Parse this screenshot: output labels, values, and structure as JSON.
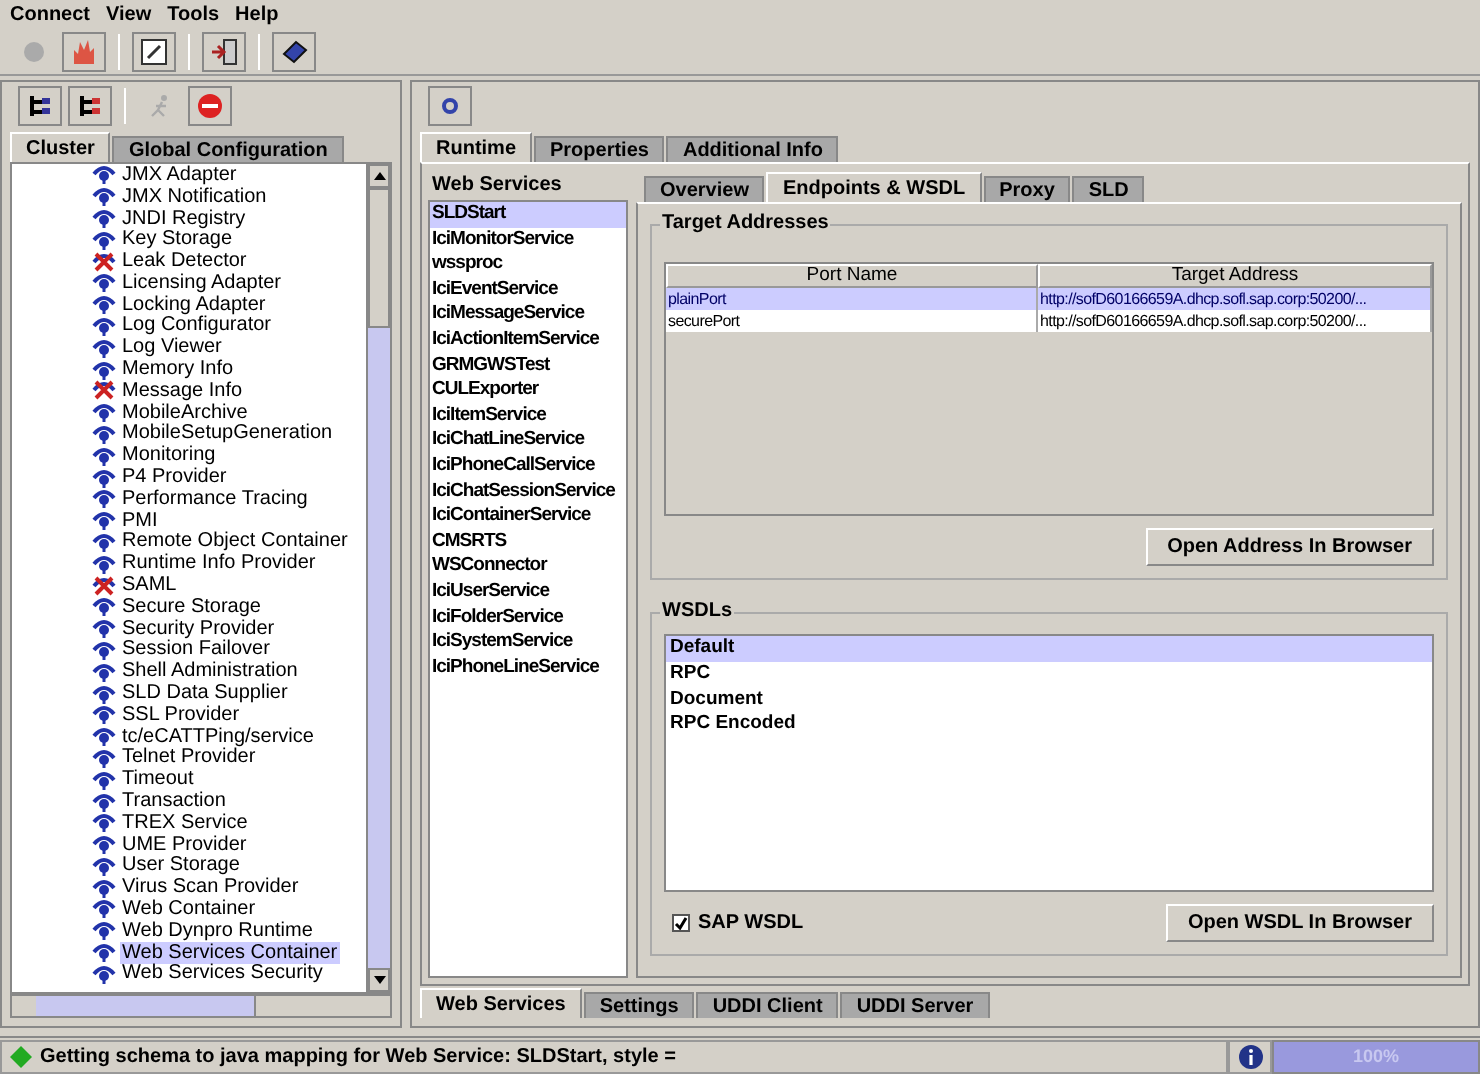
{
  "menu": [
    "Connect",
    "View",
    "Tools",
    "Help"
  ],
  "left_tabs": [
    {
      "label": "Cluster",
      "selected": true
    },
    {
      "label": "Global Configuration",
      "selected": false
    }
  ],
  "tree": [
    {
      "label": "JMX Adapter",
      "kind": "running",
      "selected": false
    },
    {
      "label": "JMX Notification",
      "kind": "running",
      "selected": false
    },
    {
      "label": "JNDI Registry",
      "kind": "running",
      "selected": false
    },
    {
      "label": "Key Storage",
      "kind": "running",
      "selected": false
    },
    {
      "label": "Leak Detector",
      "kind": "stopped",
      "selected": false
    },
    {
      "label": "Licensing Adapter",
      "kind": "running",
      "selected": false
    },
    {
      "label": "Locking Adapter",
      "kind": "running",
      "selected": false
    },
    {
      "label": "Log Configurator",
      "kind": "running",
      "selected": false
    },
    {
      "label": "Log Viewer",
      "kind": "running",
      "selected": false
    },
    {
      "label": "Memory Info",
      "kind": "running",
      "selected": false
    },
    {
      "label": "Message Info",
      "kind": "stopped",
      "selected": false
    },
    {
      "label": "MobileArchive",
      "kind": "running",
      "selected": false
    },
    {
      "label": "MobileSetupGeneration",
      "kind": "running",
      "selected": false
    },
    {
      "label": "Monitoring",
      "kind": "running",
      "selected": false
    },
    {
      "label": "P4 Provider",
      "kind": "running",
      "selected": false
    },
    {
      "label": "Performance Tracing",
      "kind": "running",
      "selected": false
    },
    {
      "label": "PMI",
      "kind": "running",
      "selected": false
    },
    {
      "label": "Remote Object Container",
      "kind": "running",
      "selected": false
    },
    {
      "label": "Runtime Info Provider",
      "kind": "running",
      "selected": false
    },
    {
      "label": "SAML",
      "kind": "stopped",
      "selected": false
    },
    {
      "label": "Secure Storage",
      "kind": "running",
      "selected": false
    },
    {
      "label": "Security Provider",
      "kind": "running",
      "selected": false
    },
    {
      "label": "Session Failover",
      "kind": "running",
      "selected": false
    },
    {
      "label": "Shell Administration",
      "kind": "running",
      "selected": false
    },
    {
      "label": "SLD Data Supplier",
      "kind": "running",
      "selected": false
    },
    {
      "label": "SSL Provider",
      "kind": "running",
      "selected": false
    },
    {
      "label": "tc/eCATTPing/service",
      "kind": "running",
      "selected": false
    },
    {
      "label": "Telnet Provider",
      "kind": "running",
      "selected": false
    },
    {
      "label": "Timeout",
      "kind": "running",
      "selected": false
    },
    {
      "label": "Transaction",
      "kind": "running",
      "selected": false
    },
    {
      "label": "TREX Service",
      "kind": "running",
      "selected": false
    },
    {
      "label": "UME Provider",
      "kind": "running",
      "selected": false
    },
    {
      "label": "User Storage",
      "kind": "running",
      "selected": false
    },
    {
      "label": "Virus Scan Provider",
      "kind": "running",
      "selected": false
    },
    {
      "label": "Web Container",
      "kind": "running",
      "selected": false
    },
    {
      "label": "Web Dynpro Runtime",
      "kind": "running",
      "selected": false
    },
    {
      "label": "Web Services Container",
      "kind": "running",
      "selected": true
    },
    {
      "label": "Web Services Security",
      "kind": "running",
      "selected": false
    }
  ],
  "main_tabs": [
    {
      "label": "Runtime",
      "selected": true
    },
    {
      "label": "Properties",
      "selected": false
    },
    {
      "label": "Additional Info",
      "selected": false
    }
  ],
  "web_services": {
    "title": "Web Services",
    "items": [
      {
        "label": "SLDStart",
        "selected": true
      },
      {
        "label": "IciMonitorService",
        "selected": false
      },
      {
        "label": "wssproc",
        "selected": false
      },
      {
        "label": "IciEventService",
        "selected": false
      },
      {
        "label": "IciMessageService",
        "selected": false
      },
      {
        "label": "IciActionItemService",
        "selected": false
      },
      {
        "label": "GRMGWSTest",
        "selected": false
      },
      {
        "label": "CULExporter",
        "selected": false
      },
      {
        "label": "IciItemService",
        "selected": false
      },
      {
        "label": "IciChatLineService",
        "selected": false
      },
      {
        "label": "IciPhoneCallService",
        "selected": false
      },
      {
        "label": "IciChatSessionService",
        "selected": false
      },
      {
        "label": "IciContainerService",
        "selected": false
      },
      {
        "label": "CMSRTS",
        "selected": false
      },
      {
        "label": "WSConnector",
        "selected": false
      },
      {
        "label": "IciUserService",
        "selected": false
      },
      {
        "label": "IciFolderService",
        "selected": false
      },
      {
        "label": "IciSystemService",
        "selected": false
      },
      {
        "label": "IciPhoneLineService",
        "selected": false
      }
    ]
  },
  "detail_tabs": [
    {
      "label": "Overview",
      "selected": false
    },
    {
      "label": "Endpoints & WSDL",
      "selected": true
    },
    {
      "label": "Proxy",
      "selected": false
    },
    {
      "label": "SLD",
      "selected": false
    }
  ],
  "target_addresses": {
    "title": "Target Addresses",
    "columns": [
      "Port Name",
      "Target Address"
    ],
    "rows": [
      {
        "cells": [
          "plainPort",
          "http://sofD60166659A.dhcp.sofl.sap.corp:50200/..."
        ],
        "selected": true
      },
      {
        "cells": [
          "securePort",
          "http://sofD60166659A.dhcp.sofl.sap.corp:50200/..."
        ],
        "selected": false
      }
    ],
    "button": "Open Address In Browser"
  },
  "wsdls": {
    "title": "WSDLs",
    "items": [
      {
        "label": "Default",
        "selected": true
      },
      {
        "label": "RPC",
        "selected": false
      },
      {
        "label": "Document",
        "selected": false
      },
      {
        "label": "RPC Encoded",
        "selected": false
      }
    ],
    "checkbox": {
      "label": "SAP WSDL",
      "checked": true
    },
    "button": "Open WSDL In Browser"
  },
  "bottom_tabs": [
    {
      "label": "Web Services",
      "selected": true
    },
    {
      "label": "Settings",
      "selected": false
    },
    {
      "label": "UDDI Client",
      "selected": false
    },
    {
      "label": "UDDI Server",
      "selected": false
    }
  ],
  "status_bar": {
    "message": "Getting schema to java mapping for Web Service: SLDStart, style =",
    "progress": {
      "level": 1,
      "label": "100%"
    }
  }
}
